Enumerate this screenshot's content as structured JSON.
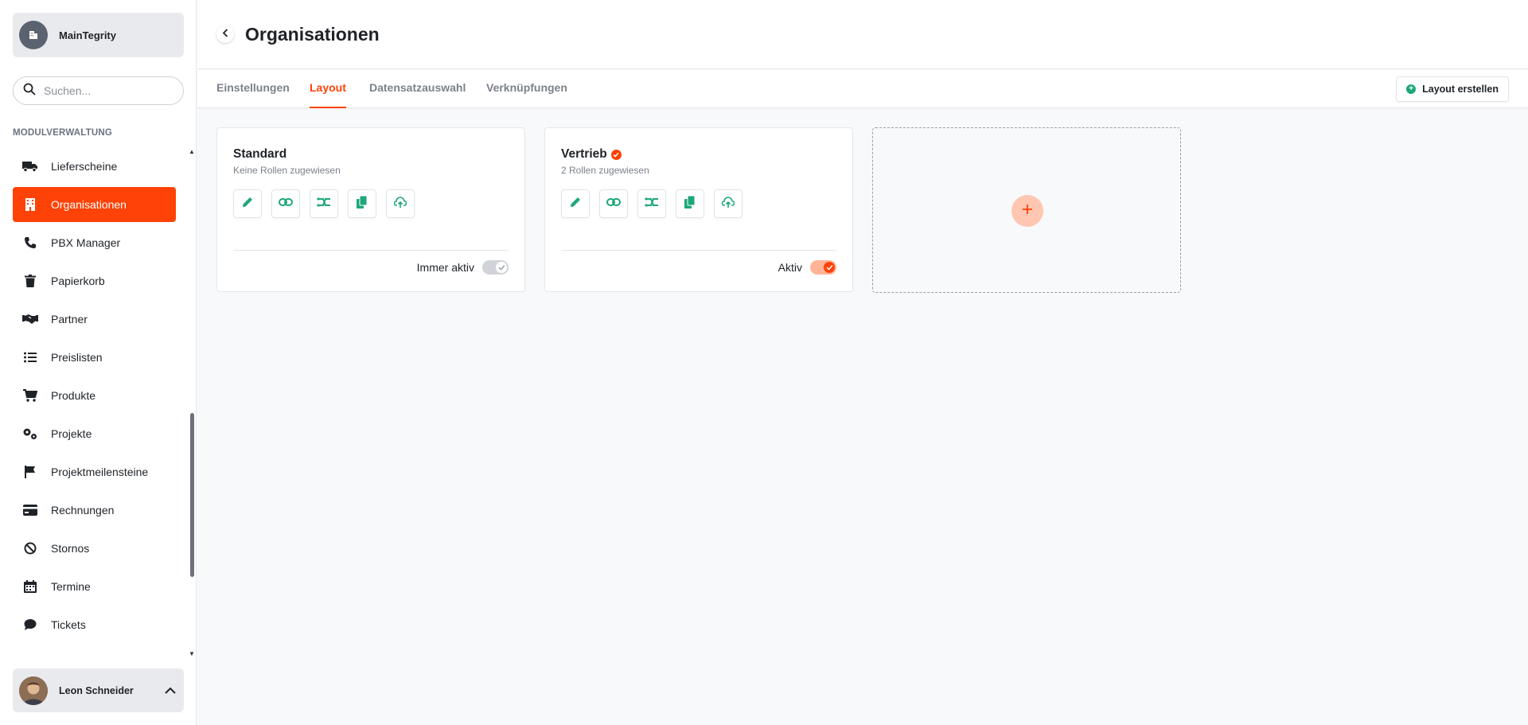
{
  "sidebar": {
    "org_name": "MainTegrity",
    "search_placeholder": "Suchen...",
    "section_label": "MODULVERWALTUNG",
    "items": [
      {
        "label": "Lieferscheine",
        "icon": "truck-icon"
      },
      {
        "label": "Organisationen",
        "icon": "building-icon",
        "active": true
      },
      {
        "label": "PBX Manager",
        "icon": "phone-icon"
      },
      {
        "label": "Papierkorb",
        "icon": "trash-icon"
      },
      {
        "label": "Partner",
        "icon": "handshake-icon"
      },
      {
        "label": "Preislisten",
        "icon": "list-icon"
      },
      {
        "label": "Produkte",
        "icon": "cart-icon"
      },
      {
        "label": "Projekte",
        "icon": "gears-icon"
      },
      {
        "label": "Projektmeilensteine",
        "icon": "flag-icon"
      },
      {
        "label": "Rechnungen",
        "icon": "credit-card-icon"
      },
      {
        "label": "Stornos",
        "icon": "ban-icon"
      },
      {
        "label": "Termine",
        "icon": "calendar-icon"
      },
      {
        "label": "Tickets",
        "icon": "chat-icon"
      }
    ],
    "user_name": "Leon Schneider"
  },
  "header": {
    "title": "Organisationen"
  },
  "tabs": [
    {
      "label": "Einstellungen"
    },
    {
      "label": "Layout",
      "active": true
    },
    {
      "label": "Datensatzauswahl"
    },
    {
      "label": "Verknüpfungen"
    }
  ],
  "create_button_label": "Layout erstellen",
  "cards": [
    {
      "title": "Standard",
      "subtitle": "Keine Rollen zugewiesen",
      "toggle_label": "Immer aktiv",
      "toggle_on": false,
      "verified": false
    },
    {
      "title": "Vertrieb",
      "subtitle": "2 Rollen zugewiesen",
      "toggle_label": "Aktiv",
      "toggle_on": true,
      "verified": true
    }
  ],
  "card_actions": [
    "pencil-icon",
    "link-icon",
    "shuffle-icon",
    "copy-icon",
    "upload-icon"
  ],
  "colors": {
    "accent": "#ff4208",
    "action_green": "#1ea77a"
  }
}
